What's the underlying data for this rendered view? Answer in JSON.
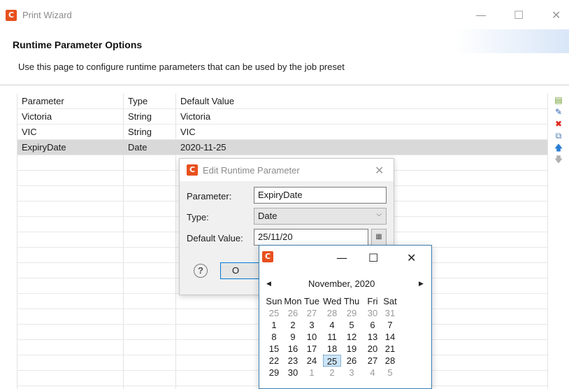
{
  "window": {
    "title": "Print Wizard",
    "logo": "C",
    "minimize": "—",
    "maximize": "☐",
    "close": "✕"
  },
  "page": {
    "heading": "Runtime Parameter Options",
    "description": "Use this page to configure runtime parameters that can be used by the job preset"
  },
  "table": {
    "columns": [
      "Parameter",
      "Type",
      "Default Value"
    ],
    "rows": [
      {
        "parameter": "Victoria",
        "type": "String",
        "default": "Victoria"
      },
      {
        "parameter": "VIC",
        "type": "String",
        "default": "VIC"
      },
      {
        "parameter": "ExpiryDate",
        "type": "Date",
        "default": "2020-11-25"
      }
    ],
    "selected_row": 2
  },
  "side_toolbar": {
    "icons": [
      "new-parameter-icon",
      "edit-pencil-icon",
      "delete-x-icon",
      "copy-icon",
      "move-up-icon",
      "move-down-icon"
    ],
    "colors": {
      "delete": "#e0241a",
      "move_up": "#2a7fd4",
      "edit": "#2a5db0"
    }
  },
  "edit_dialog": {
    "title": "Edit Runtime Parameter",
    "logo": "C",
    "close": "✕",
    "parameter_label": "Parameter:",
    "parameter_value": "ExpiryDate",
    "type_label": "Type:",
    "type_value": "Date",
    "default_label": "Default Value:",
    "default_value": "25/11/20",
    "help": "?",
    "ok_label": "O"
  },
  "calendar": {
    "logo": "C",
    "minimize": "—",
    "maximize": "☐",
    "close": "✕",
    "prev": "◀",
    "next": "▶",
    "month": "November, 2020",
    "weekdays": [
      "Sun",
      "Mon",
      "Tue",
      "Wed",
      "Thu",
      "Fri",
      "Sat"
    ],
    "weeks": [
      [
        "25",
        "26",
        "27",
        "28",
        "29",
        "30",
        "31"
      ],
      [
        "1",
        "2",
        "3",
        "4",
        "5",
        "6",
        "7"
      ],
      [
        "8",
        "9",
        "10",
        "11",
        "12",
        "13",
        "14"
      ],
      [
        "15",
        "16",
        "17",
        "18",
        "19",
        "20",
        "21"
      ],
      [
        "22",
        "23",
        "24",
        "25",
        "26",
        "27",
        "28"
      ],
      [
        "29",
        "30",
        "1",
        "2",
        "3",
        "4",
        "5"
      ]
    ],
    "selected_day": "25"
  },
  "colors": {
    "accent": "#e8501e",
    "selection": "#d9d9d9",
    "focus_border": "#0078d7",
    "calendar_border": "#3c7fb1"
  }
}
